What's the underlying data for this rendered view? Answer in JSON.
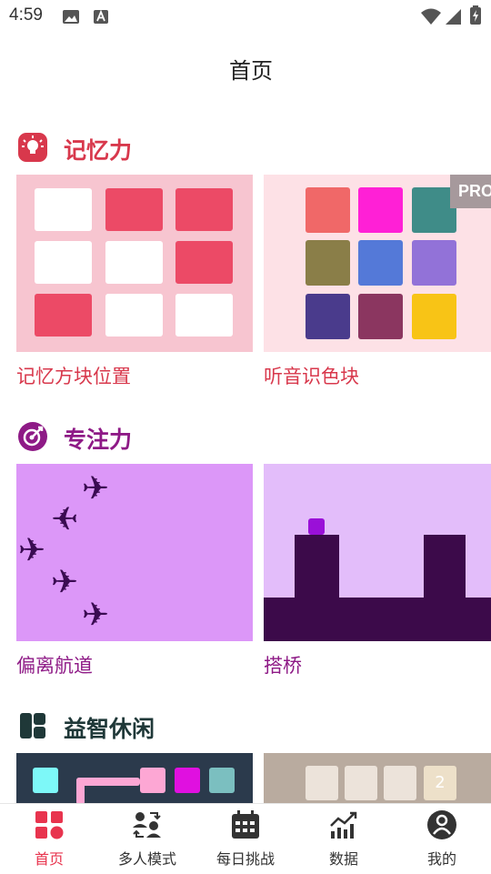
{
  "status_bar": {
    "time": "4:59"
  },
  "header": {
    "title": "首页"
  },
  "sections": {
    "memory": {
      "title": "记忆力",
      "color": "#d8384c"
    },
    "focus": {
      "title": "专注力",
      "color": "#8e1a86"
    },
    "puzzle": {
      "title": "益智休闲",
      "color": "#1f3838"
    }
  },
  "cards": {
    "memory_blocks": {
      "label": "记忆方块位置"
    },
    "color_listen": {
      "label": "听音识色块",
      "badge": "PRO"
    },
    "off_course": {
      "label": "偏离航道"
    },
    "bridge": {
      "label": "搭桥"
    },
    "number_tiles": {
      "tile_value": "2"
    }
  },
  "bottom_nav": [
    {
      "label": "首页",
      "icon": "home-grid-icon",
      "active": true
    },
    {
      "label": "多人模式",
      "icon": "multiplayer-icon",
      "active": false
    },
    {
      "label": "每日挑战",
      "icon": "calendar-icon",
      "active": false
    },
    {
      "label": "数据",
      "icon": "chart-trend-icon",
      "active": false
    },
    {
      "label": "我的",
      "icon": "user-icon",
      "active": false
    }
  ],
  "colors": {
    "accent": "#e8344e",
    "memory_card_bg": "#f7c5d0",
    "color_card_bg": "#fde1e6",
    "focus_card_bg": "#dc97f8",
    "bridge_sky": "#e3bdfa",
    "bridge_ground": "#3c0a4a"
  }
}
